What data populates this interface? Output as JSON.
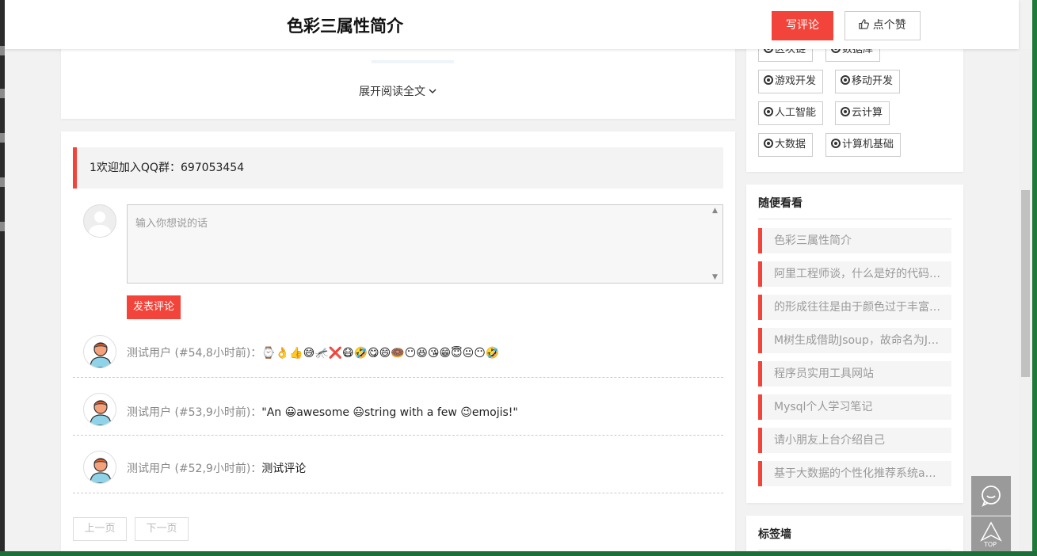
{
  "header": {
    "title": "色彩三属性简介",
    "write_comment": "写评论",
    "like": "点个赞"
  },
  "article": {
    "expand_label": "展开阅读全文"
  },
  "comments_section": {
    "notice": "1欢迎加入QQ群：697053454",
    "input_placeholder": "输入你想说的话",
    "submit_label": "发表评论",
    "comments": [
      {
        "user": "测试用户",
        "meta": "(#54,8小时前)：",
        "text": "⌚👌👍😅🦟❌😷🤣😋😄🍩😶😆😘😁😇😐😶🤣"
      },
      {
        "user": "测试用户",
        "meta": "(#53,9小时前)：",
        "text": "\"An 😀awesome 😃string with a few 😉emojis!\""
      },
      {
        "user": "测试用户",
        "meta": "(#52,9小时前)：",
        "text": "测试评论"
      }
    ],
    "prev_page": "上一页",
    "next_page": "下一页"
  },
  "sidebar": {
    "tags_partial": [
      "区块链",
      "数据库"
    ],
    "tags": [
      "游戏开发",
      "移动开发",
      "人工智能",
      "云计算",
      "大数据",
      "计算机基础"
    ],
    "random_title": "随便看看",
    "random_items": [
      "色彩三属性简介",
      "阿里工程师谈，什么是好的代码…",
      "的形成往往是由于颜色过于丰富…",
      "M树生成借助Jsoup，故命名为J…",
      "程序员实用工具网站",
      "Mysql个人学习笔记",
      "请小朋友上台介绍自己",
      "基于大数据的个性化推荐系统a…"
    ],
    "tag_wall_title": "标签墙"
  },
  "float": {
    "top_label": "TOP"
  },
  "colors": {
    "accent": "#f2443a",
    "background": "#f2f2f2",
    "float_button": "#9a9a9a"
  }
}
